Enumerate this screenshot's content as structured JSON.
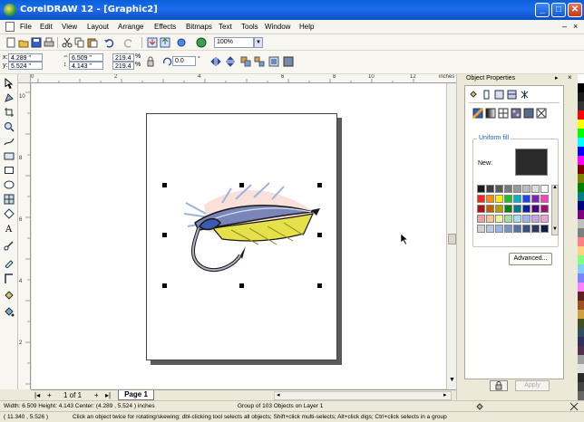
{
  "window": {
    "title": "CorelDRAW 12 - [Graphic2]"
  },
  "menu": [
    "File",
    "Edit",
    "View",
    "Layout",
    "Arrange",
    "Effects",
    "Bitmaps",
    "Text",
    "Tools",
    "Window",
    "Help"
  ],
  "toolbar": {
    "zoom": "100%"
  },
  "property_bar": {
    "x": "4.289 \"",
    "y": "5.524 \"",
    "width": "6.509 \"",
    "height": "4.143 \"",
    "scale_x": "219.4",
    "scale_y": "219.4",
    "scale_unit": "%",
    "rotation": "0.0"
  },
  "ruler": {
    "units": "inches",
    "h_labels": [
      "0",
      "2",
      "4",
      "6",
      "8",
      "10",
      "12"
    ],
    "v_labels": [
      "10",
      "8",
      "6",
      "4",
      "2"
    ]
  },
  "page_nav": {
    "current": "1 of 1",
    "tab": "Page 1"
  },
  "docker": {
    "title": "Object Properties",
    "fill_group": "Uniform fill",
    "new_label": "New:",
    "new_color": "#2a2a2a",
    "advanced_label": "Advanced...",
    "apply_label": "Apply",
    "palette": [
      "#1a1a1a",
      "#3d3d3d",
      "#5a5a5a",
      "#7a7a7a",
      "#9a9a9a",
      "#bcbcbc",
      "#dcdcdc",
      "#ffffff",
      "#ff2020",
      "#ff8c00",
      "#ffee00",
      "#20c020",
      "#00b4c8",
      "#2040ff",
      "#8020c0",
      "#ff40c0",
      "#b01010",
      "#c06000",
      "#b0a000",
      "#108010",
      "#007890",
      "#1020a0",
      "#500080",
      "#a01070",
      "#f0a0a0",
      "#f0c890",
      "#f0f0a0",
      "#a0e0a0",
      "#a0e0f0",
      "#a0b0f0",
      "#c8a0e8",
      "#f0a0d8",
      "#d0d0d8",
      "#b8c8e0",
      "#9cb4e0",
      "#7894c8",
      "#5470a8",
      "#3c5080",
      "#283860",
      "#101c40"
    ]
  },
  "color_strip": [
    "#ffffff",
    "#000000",
    "#1a1a1a",
    "#333333",
    "#ff0000",
    "#ffff00",
    "#00ff00",
    "#00ffff",
    "#0000ff",
    "#ff00ff",
    "#800000",
    "#808000",
    "#008000",
    "#008080",
    "#000080",
    "#800080",
    "#c0c0c0",
    "#808080",
    "#ff8080",
    "#ffd080",
    "#80ff80",
    "#80d0ff",
    "#8080ff",
    "#ff80ff",
    "#602020",
    "#a05020",
    "#d0a040",
    "#405020",
    "#305060",
    "#303060",
    "#503050",
    "#a0a0a0",
    "#e0e0e0",
    "#2a2a2a",
    "#444444",
    "#666666"
  ],
  "status": {
    "line1": "Width: 6.509  Height: 4.143  Center: (4.289 , 5.524 )  inches",
    "line1b": "Group of 103 Objects on Layer 1",
    "line2a": "( 11.340 , 5.526 )",
    "line2b": "Click an object twice for rotating/skewing; dbl-clicking tool selects all objects; Shift+click multi-selects; Alt+click digs; Ctrl+click selects in a group"
  }
}
